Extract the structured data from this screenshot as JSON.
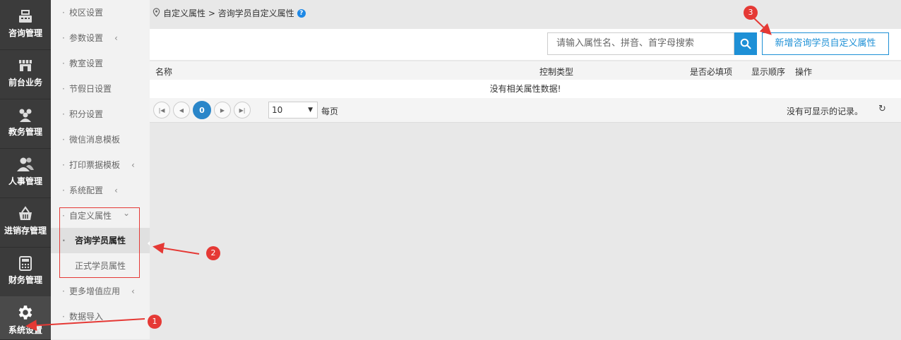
{
  "rail": {
    "items": [
      {
        "label": "咨询管理",
        "icon": "register-icon"
      },
      {
        "label": "前台业务",
        "icon": "store-icon"
      },
      {
        "label": "教务管理",
        "icon": "group-icon"
      },
      {
        "label": "人事管理",
        "icon": "people-icon"
      },
      {
        "label": "进销存管理",
        "icon": "basket-icon"
      },
      {
        "label": "财务管理",
        "icon": "calculator-icon"
      },
      {
        "label": "系统设置",
        "icon": "gear-icon"
      }
    ]
  },
  "subnav": {
    "items": [
      {
        "label": "校区设置"
      },
      {
        "label": "参数设置",
        "chevron": "‹"
      },
      {
        "label": "教室设置"
      },
      {
        "label": "节假日设置"
      },
      {
        "label": "积分设置"
      },
      {
        "label": "微信消息模板"
      },
      {
        "label": "打印票据模板",
        "chevron": "‹"
      },
      {
        "label": "系统配置",
        "chevron": "‹"
      },
      {
        "label": "自定义属性",
        "chevron": "⌄"
      },
      {
        "label": "咨询学员属性"
      },
      {
        "label": "正式学员属性"
      },
      {
        "label": "更多增值应用",
        "chevron": "‹"
      },
      {
        "label": "数据导入"
      }
    ]
  },
  "breadcrumb": {
    "text": "自定义属性 > 咨询学员自定义属性",
    "help": "?"
  },
  "search": {
    "placeholder": "请输入属性名、拼音、首字母搜索"
  },
  "add_button": {
    "label": "新增咨询学员自定义属性"
  },
  "table": {
    "headers": [
      "名称",
      "控制类型",
      "是否必填项",
      "显示顺序",
      "操作"
    ],
    "empty_text": "没有相关属性数据!"
  },
  "pager": {
    "current_page": "0",
    "page_size": "10",
    "per_page_label": "每页",
    "no_records": "没有可显示的记录。"
  },
  "annotations": [
    "1",
    "2",
    "3"
  ],
  "colors": {
    "accent": "#1e90d6",
    "annotation": "#e53935",
    "rail": "#3b3b3b"
  }
}
